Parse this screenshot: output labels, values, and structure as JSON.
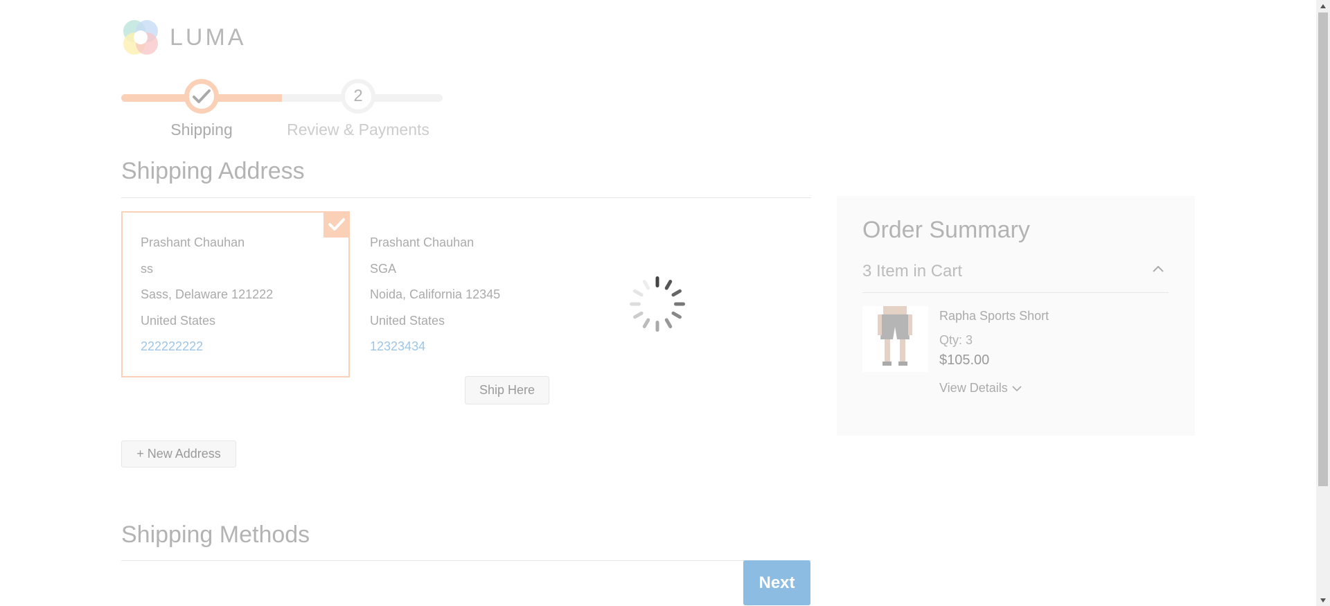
{
  "brand": {
    "logo_text": "LUMA"
  },
  "progress": {
    "steps": [
      {
        "label": "Shipping",
        "status": "complete"
      },
      {
        "number": "2",
        "label": "Review & Payments",
        "status": "pending"
      }
    ]
  },
  "shipping_address": {
    "title": "Shipping Address",
    "addresses": [
      {
        "name": "Prashant Chauhan",
        "street": "ss",
        "city_region_zip": "Sass, Delaware 121222",
        "country": "United States",
        "phone": "222222222",
        "selected": true
      },
      {
        "name": "Prashant Chauhan",
        "street": "SGA",
        "city_region_zip": "Noida, California 12345",
        "country": "United States",
        "phone": "12323434",
        "selected": false
      }
    ],
    "ship_here_label": "Ship Here",
    "new_address_label": "+ New Address"
  },
  "shipping_methods": {
    "title": "Shipping Methods"
  },
  "next_label": "Next",
  "order_summary": {
    "title": "Order Summary",
    "cart_count_text": "3 Item in Cart",
    "items": [
      {
        "name": "Rapha Sports Short",
        "qty_text": "Qty: 3",
        "price": "$105.00",
        "view_details": "View Details"
      }
    ]
  },
  "colors": {
    "accent": "#f5a26d",
    "link": "#3b8bcf",
    "primary_button": "#1979c3",
    "summary_bg": "#f5f5f5"
  },
  "icons": [
    "check-icon",
    "chevron-up-icon",
    "chevron-down-icon",
    "loading-spinner-icon"
  ]
}
